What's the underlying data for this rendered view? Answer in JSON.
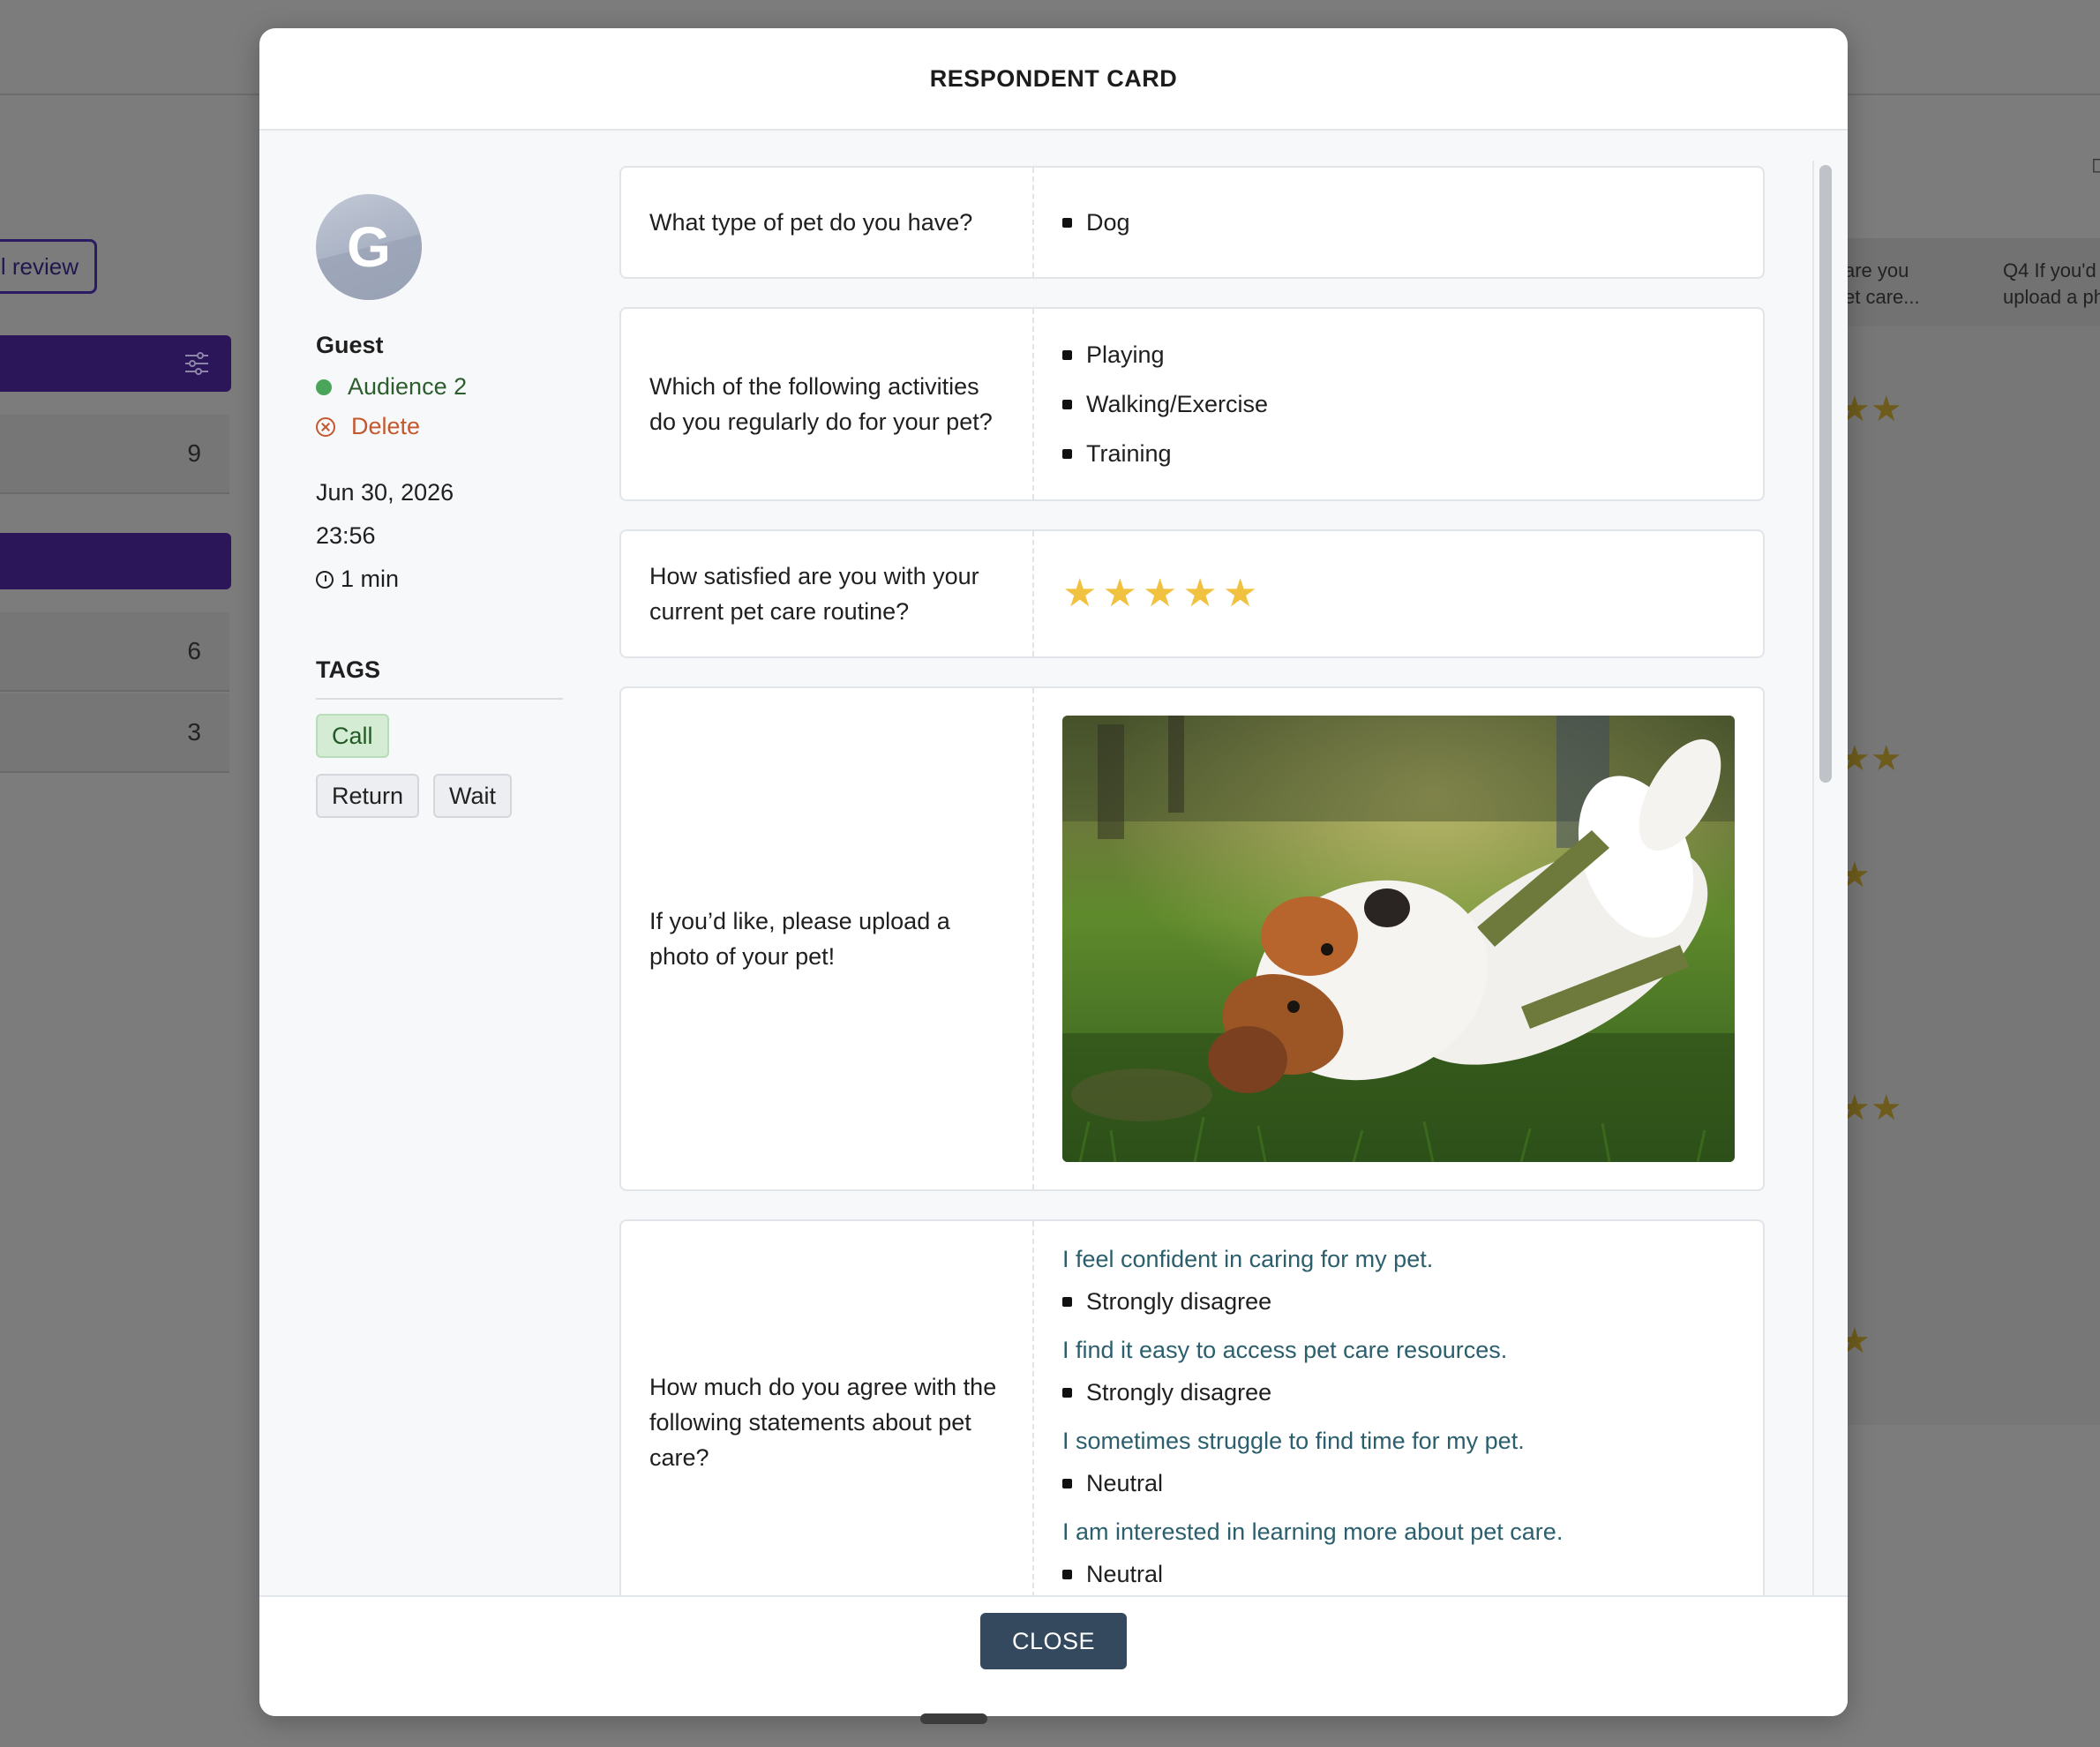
{
  "background": {
    "review_button": "l review",
    "counts": [
      "9",
      "6",
      "3"
    ],
    "column_headers": [
      "are you\net care...",
      "Q4 If you'd\nupload a ph"
    ]
  },
  "modal": {
    "title": "RESPONDENT CARD",
    "close_label": "CLOSE"
  },
  "respondent": {
    "avatar_letter": "G",
    "name": "Guest",
    "audience": "Audience 2",
    "delete_label": "Delete",
    "date": "Jun 30, 2026",
    "time": "23:56",
    "duration": "1 min",
    "tags_title": "TAGS",
    "tags": [
      {
        "label": "Call",
        "color": "#d4ecd4"
      },
      {
        "label": "Return",
        "color": "#eceef1"
      },
      {
        "label": "Wait",
        "color": "#eceef1"
      }
    ]
  },
  "questions": [
    {
      "question": "What type of pet do you have?",
      "answers": [
        "Dog"
      ]
    },
    {
      "question": "Which of the following activities do you regularly do for your pet?",
      "answers": [
        "Playing",
        "Walking/Exercise",
        "Training"
      ]
    },
    {
      "question": "How satisfied are you with your current pet care routine?",
      "rating": 5,
      "rating_max": 5
    },
    {
      "question": "If you’d like, please upload a photo of your pet!",
      "image": "photo of a dog lying on grass"
    },
    {
      "question": "How much do you agree with the following statements about pet care?",
      "statements": [
        {
          "statement": "I feel confident in caring for my pet.",
          "answer": "Strongly disagree"
        },
        {
          "statement": "I find it easy to access pet care resources.",
          "answer": "Strongly disagree"
        },
        {
          "statement": "I sometimes struggle to find time for my pet.",
          "answer": "Neutral"
        },
        {
          "statement": "I am interested in learning more about pet care.",
          "answer": "Neutral"
        }
      ]
    }
  ],
  "colors": {
    "accent": "#2a1659",
    "close_button": "#34495e",
    "star": "#f0c240",
    "statement_text": "#2b5f6d"
  }
}
